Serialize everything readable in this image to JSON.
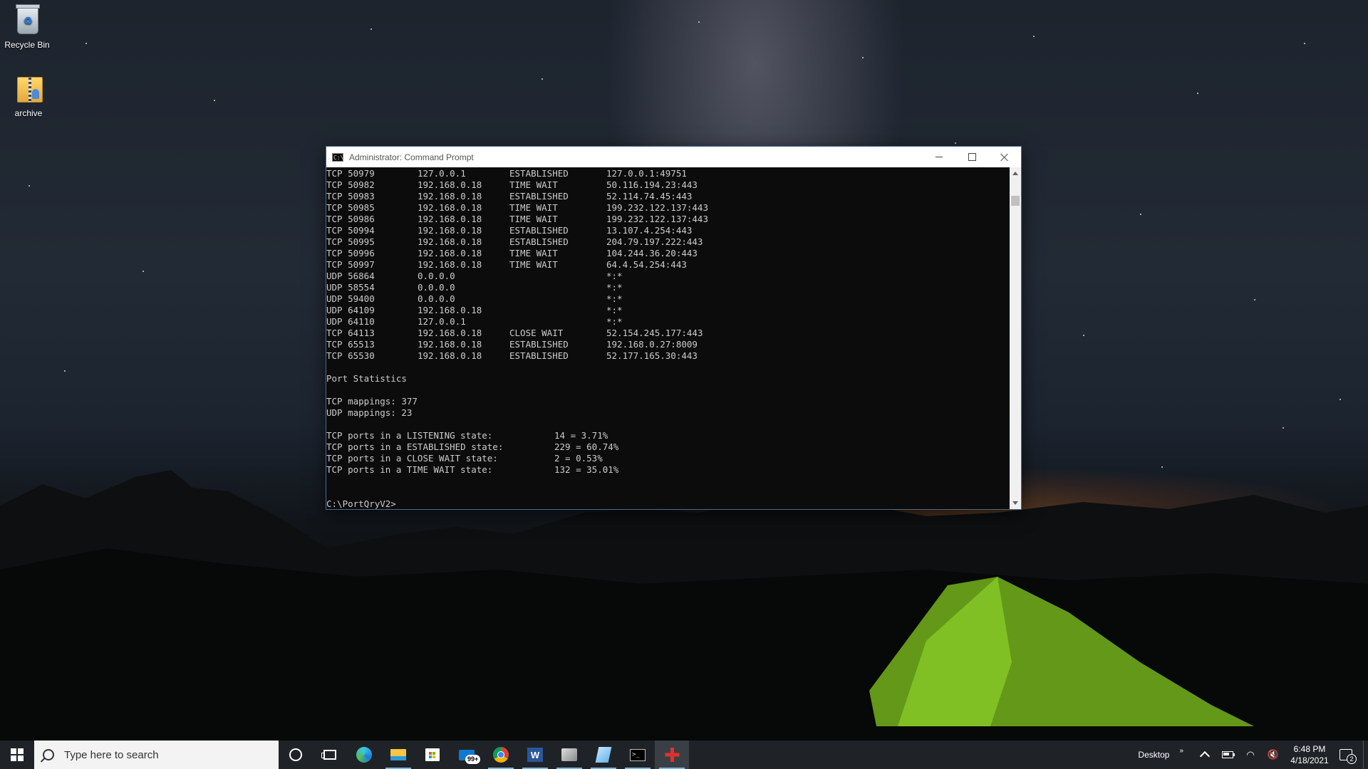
{
  "desktop": {
    "icons": [
      {
        "label": "Recycle Bin",
        "icon": "recycle-bin-icon"
      },
      {
        "label": "archive",
        "icon": "zip-folder-icon"
      }
    ]
  },
  "window": {
    "title": "Administrator: Command Prompt",
    "connections": [
      {
        "proto_port": "TCP 50979",
        "local": "127.0.0.1",
        "state": "ESTABLISHED",
        "remote": "127.0.0.1:49751"
      },
      {
        "proto_port": "TCP 50982",
        "local": "192.168.0.18",
        "state": "TIME WAIT",
        "remote": "50.116.194.23:443"
      },
      {
        "proto_port": "TCP 50983",
        "local": "192.168.0.18",
        "state": "ESTABLISHED",
        "remote": "52.114.74.45:443"
      },
      {
        "proto_port": "TCP 50985",
        "local": "192.168.0.18",
        "state": "TIME WAIT",
        "remote": "199.232.122.137:443"
      },
      {
        "proto_port": "TCP 50986",
        "local": "192.168.0.18",
        "state": "TIME WAIT",
        "remote": "199.232.122.137:443"
      },
      {
        "proto_port": "TCP 50994",
        "local": "192.168.0.18",
        "state": "ESTABLISHED",
        "remote": "13.107.4.254:443"
      },
      {
        "proto_port": "TCP 50995",
        "local": "192.168.0.18",
        "state": "ESTABLISHED",
        "remote": "204.79.197.222:443"
      },
      {
        "proto_port": "TCP 50996",
        "local": "192.168.0.18",
        "state": "TIME WAIT",
        "remote": "104.244.36.20:443"
      },
      {
        "proto_port": "TCP 50997",
        "local": "192.168.0.18",
        "state": "TIME WAIT",
        "remote": "64.4.54.254:443"
      },
      {
        "proto_port": "UDP 56864",
        "local": "0.0.0.0",
        "state": "",
        "remote": "*:*"
      },
      {
        "proto_port": "UDP 58554",
        "local": "0.0.0.0",
        "state": "",
        "remote": "*:*"
      },
      {
        "proto_port": "UDP 59400",
        "local": "0.0.0.0",
        "state": "",
        "remote": "*:*"
      },
      {
        "proto_port": "UDP 64109",
        "local": "192.168.0.18",
        "state": "",
        "remote": "*:*"
      },
      {
        "proto_port": "UDP 64110",
        "local": "127.0.0.1",
        "state": "",
        "remote": "*:*"
      },
      {
        "proto_port": "TCP 64113",
        "local": "192.168.0.18",
        "state": "CLOSE WAIT",
        "remote": "52.154.245.177:443"
      },
      {
        "proto_port": "TCP 65513",
        "local": "192.168.0.18",
        "state": "ESTABLISHED",
        "remote": "192.168.0.27:8009"
      },
      {
        "proto_port": "TCP 65530",
        "local": "192.168.0.18",
        "state": "ESTABLISHED",
        "remote": "52.177.165.30:443"
      }
    ],
    "stats_heading": "Port Statistics",
    "tcp_mappings": "TCP mappings: 377",
    "udp_mappings": "UDP mappings: 23",
    "states": [
      {
        "label": "TCP ports in a LISTENING state:",
        "value": "14 = 3.71%"
      },
      {
        "label": "TCP ports in a ESTABLISHED state:",
        "value": "229 = 60.74%"
      },
      {
        "label": "TCP ports in a CLOSE WAIT state:",
        "value": "2 = 0.53%"
      },
      {
        "label": "TCP ports in a TIME WAIT state:",
        "value": "132 = 35.01%"
      }
    ],
    "prompt": "C:\\PortQryV2>"
  },
  "taskbar": {
    "search_placeholder": "Type here to search",
    "apps": [
      {
        "name": "cortana-icon"
      },
      {
        "name": "task-view-icon"
      },
      {
        "name": "edge-icon"
      },
      {
        "name": "file-explorer-icon"
      },
      {
        "name": "store-icon"
      },
      {
        "name": "mail-icon",
        "badge": "99+"
      },
      {
        "name": "chrome-icon"
      },
      {
        "name": "word-icon"
      },
      {
        "name": "app-icon"
      },
      {
        "name": "app-icon-2"
      },
      {
        "name": "command-prompt-icon"
      },
      {
        "name": "tool-icon"
      }
    ],
    "tray": {
      "desktop_label": "Desktop",
      "time": "6:48 PM",
      "date": "4/18/2021",
      "notification_count": "2"
    }
  },
  "colors": {
    "console_bg": "#0c0c0c",
    "console_text": "#cccccc",
    "taskbar_bg": "#1f2328",
    "accent": "#76b9ed"
  }
}
